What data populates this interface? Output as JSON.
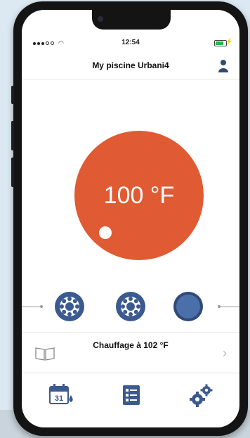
{
  "status_bar": {
    "time": "12:54",
    "battery_color": "#2db34a"
  },
  "header": {
    "title": "My piscine Urbani4",
    "user_icon": "user-icon"
  },
  "temperature": {
    "display": "100 °F",
    "accent_color": "#e05a33"
  },
  "pumps": [
    {
      "name": "pump-1",
      "state": "off"
    },
    {
      "name": "pump-2",
      "state": "off"
    },
    {
      "name": "pump-3",
      "state": "on"
    }
  ],
  "info": {
    "text": "Chauffage à 102 °F",
    "book_icon": "book-icon",
    "chevron_icon": "chevron-right-icon"
  },
  "toolbar": {
    "calendar_icon": "calendar-icon",
    "calendar_day": "31",
    "list_icon": "list-icon",
    "settings_icon": "gears-icon",
    "icon_color": "#3b5a8f"
  }
}
